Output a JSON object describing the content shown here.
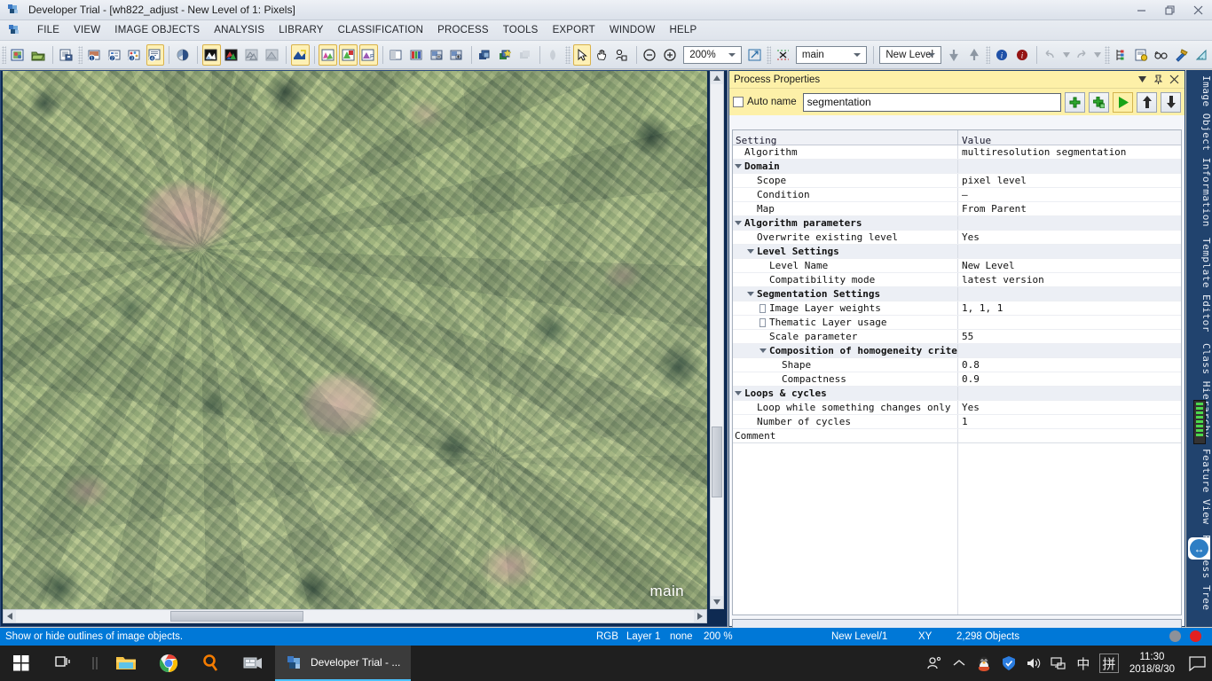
{
  "window": {
    "title": "Developer Trial - [wh822_adjust - New Level of 1: Pixels]",
    "app_icon": "ecognition-icon",
    "minimize": "–",
    "maximize": "❐",
    "close": "✕"
  },
  "menubar": {
    "items": [
      {
        "label": "FILE",
        "name": "menu-file"
      },
      {
        "label": "VIEW",
        "name": "menu-view"
      },
      {
        "label": "IMAGE OBJECTS",
        "name": "menu-image-objects"
      },
      {
        "label": "ANALYSIS",
        "name": "menu-analysis"
      },
      {
        "label": "LIBRARY",
        "name": "menu-library"
      },
      {
        "label": "CLASSIFICATION",
        "name": "menu-classification"
      },
      {
        "label": "PROCESS",
        "name": "menu-process"
      },
      {
        "label": "TOOLS",
        "name": "menu-tools"
      },
      {
        "label": "EXPORT",
        "name": "menu-export"
      },
      {
        "label": "WINDOW",
        "name": "menu-window"
      },
      {
        "label": "HELP",
        "name": "menu-help"
      }
    ]
  },
  "toolbar": {
    "zoom_value": "200%",
    "map_select_value": "main",
    "level_select_value": "New Level"
  },
  "image_view": {
    "map_label": "main"
  },
  "panel": {
    "title": "Process Properties",
    "auto_name_label": "Auto name",
    "process_name": "segmentation",
    "columns": {
      "setting": "Setting",
      "value": "Value"
    },
    "comment_label": "Comment",
    "rows": [
      {
        "label": "Algorithm",
        "value": "multiresolution segmentation",
        "indent": 0,
        "group": false,
        "twisty": "none"
      },
      {
        "label": "Domain",
        "value": "",
        "indent": 0,
        "group": true,
        "twisty": "down"
      },
      {
        "label": "Scope",
        "value": "pixel level",
        "indent": 1,
        "group": false,
        "twisty": "none"
      },
      {
        "label": "Condition",
        "value": "—",
        "indent": 1,
        "group": false,
        "twisty": "none"
      },
      {
        "label": "Map",
        "value": "From Parent",
        "indent": 1,
        "group": false,
        "twisty": "none"
      },
      {
        "label": "Algorithm parameters",
        "value": "",
        "indent": 0,
        "group": true,
        "twisty": "down"
      },
      {
        "label": "Overwrite existing level",
        "value": "Yes",
        "indent": 1,
        "group": false,
        "twisty": "none"
      },
      {
        "label": "Level Settings",
        "value": "",
        "indent": 1,
        "group": true,
        "twisty": "down"
      },
      {
        "label": "Level Name",
        "value": "New Level",
        "indent": 2,
        "group": false,
        "twisty": "none"
      },
      {
        "label": "Compatibility mode",
        "value": "latest version",
        "indent": 2,
        "group": false,
        "twisty": "none"
      },
      {
        "label": "Segmentation Settings",
        "value": "",
        "indent": 1,
        "group": true,
        "twisty": "down"
      },
      {
        "label": "Image Layer weights",
        "value": "1, 1, 1",
        "indent": 2,
        "group": false,
        "twisty": "right"
      },
      {
        "label": "Thematic Layer usage",
        "value": "",
        "indent": 2,
        "group": false,
        "twisty": "right"
      },
      {
        "label": "Scale parameter",
        "value": "55",
        "indent": 2,
        "group": false,
        "twisty": "none"
      },
      {
        "label": "Composition of homogeneity criterion",
        "value": "",
        "indent": 2,
        "group": true,
        "twisty": "down"
      },
      {
        "label": "Shape",
        "value": "0.8",
        "indent": 3,
        "group": false,
        "twisty": "none"
      },
      {
        "label": "Compactness",
        "value": "0.9",
        "indent": 3,
        "group": false,
        "twisty": "none"
      },
      {
        "label": "Loops & cycles",
        "value": "",
        "indent": 0,
        "group": true,
        "twisty": "down"
      },
      {
        "label": "Loop while something changes only",
        "value": "Yes",
        "indent": 1,
        "group": false,
        "twisty": "none"
      },
      {
        "label": "Number of cycles",
        "value": "1",
        "indent": 1,
        "group": false,
        "twisty": "none"
      }
    ]
  },
  "side_tabs": [
    {
      "label": "Image Object Information",
      "name": "tab-image-object-information"
    },
    {
      "label": "Template Editor",
      "name": "tab-template-editor"
    },
    {
      "label": "Class Hierarchy",
      "name": "tab-class-hierarchy"
    },
    {
      "label": "Feature View",
      "name": "tab-feature-view"
    },
    {
      "label": "Process Tree",
      "name": "tab-process-tree"
    }
  ],
  "statusbar": {
    "message": "Show or hide outlines of image objects.",
    "rgb": "RGB",
    "layer": "Layer 1",
    "none": "none",
    "zoom": "200 %",
    "level": "New Level/1",
    "coords": "XY",
    "objects": "2,298 Objects"
  },
  "taskbar": {
    "start": "start-icon",
    "task_view": "task-view-icon",
    "explorer": "file-explorer-icon",
    "chrome": "chrome-icon",
    "search": "search-icon",
    "app_window_label": "Developer Trial - ...",
    "time": "11:30",
    "date": "2018/8/30",
    "ime_zh": "中",
    "ime_pinyin": "拼"
  },
  "colors": {
    "accent_blue": "#0078d7",
    "panel_yellow": "#fdf0a8",
    "frame_navy": "#21436e",
    "taskbar": "#1f1f1f"
  }
}
